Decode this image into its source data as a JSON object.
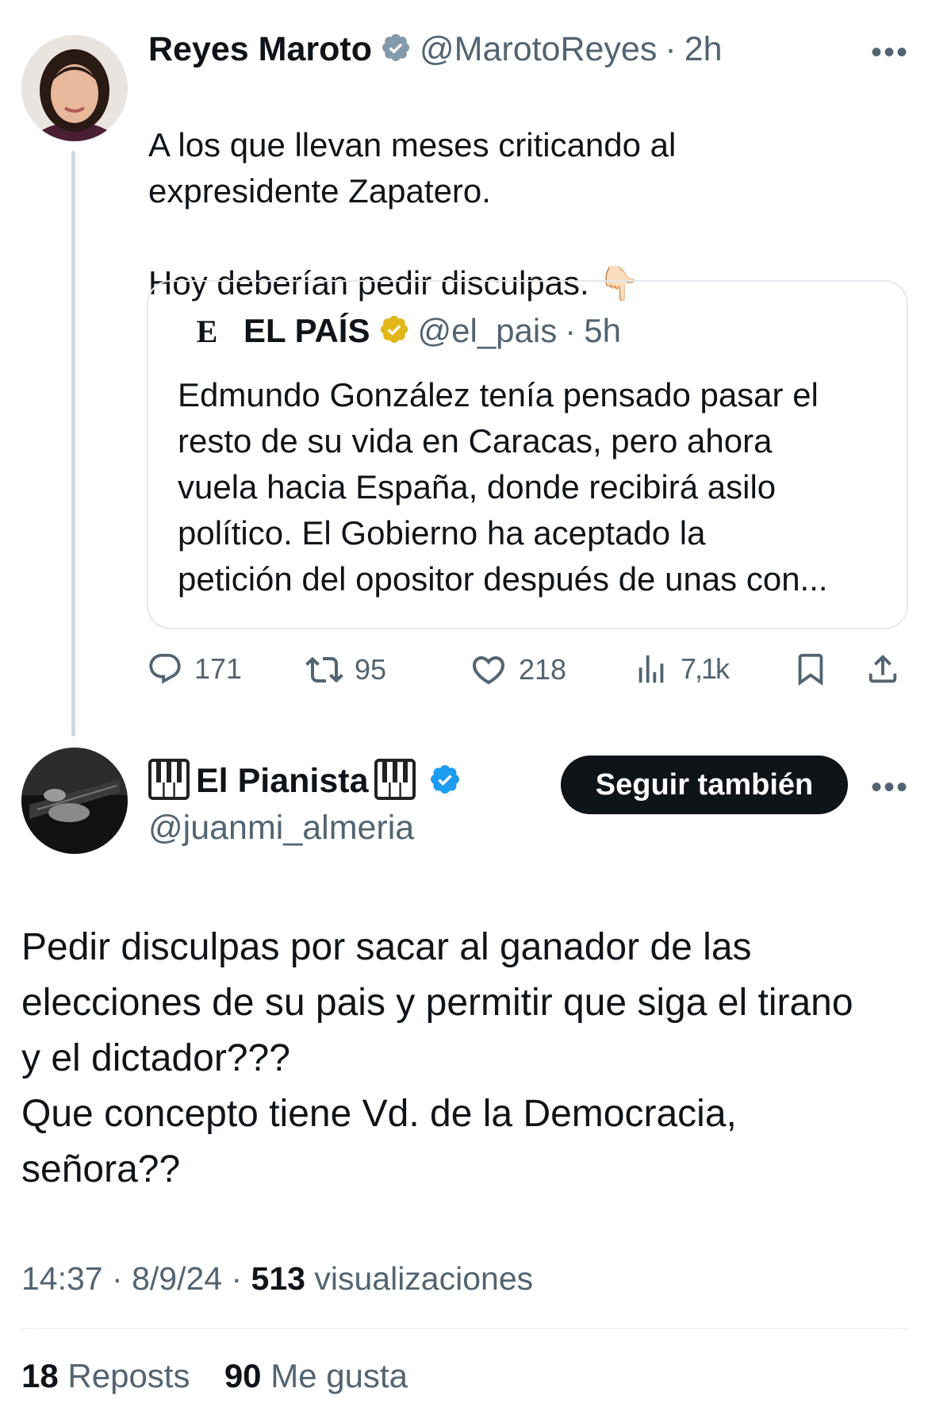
{
  "original_tweet": {
    "author_name": "Reyes Maroto",
    "handle": "@MarotoReyes",
    "time": "2h",
    "text": "A los que llevan meses criticando al\nexpresidente Zapatero.\n\nHoy deberían pedir disculpas.",
    "emoji": "👇🏻",
    "quote": {
      "logo": "E",
      "author_name": "EL PAÍS",
      "handle": "@el_pais",
      "time": "5h",
      "text": "Edmundo González tenía pensado pasar el\nresto de su vida en Caracas, pero ahora\nvuela hacia España, donde recibirá asilo\npolítico. El Gobierno ha aceptado la\npetición del opositor después de unas con..."
    },
    "actions": {
      "replies": "171",
      "reposts": "95",
      "likes": "218",
      "views": "7,1k"
    }
  },
  "reply_tweet": {
    "author_name": "El Pianista",
    "handle": "@juanmi_almeria",
    "follow_label": "Seguir también",
    "text": "Pedir disculpas por sacar al ganador de las\nelecciones de su pais y permitir que siga el tirano\ny el dictador???\nQue concepto tiene Vd. de la Democracia,\nseñora??",
    "time": "14:37",
    "date": "8/9/24",
    "views_count": "513",
    "views_label": "visualizaciones",
    "reposts_count": "18",
    "reposts_label": "Reposts",
    "likes_count": "90",
    "likes_label": "Me gusta"
  },
  "colors": {
    "text_primary": "#0f1419",
    "text_secondary": "#536471",
    "verified_blue": "#1d9bf0",
    "verified_gray": "#829aab",
    "verified_gold": "#e2b719",
    "thread_line": "#cfd9de"
  },
  "icons": [
    "verified-gray-icon",
    "verified-gold-icon",
    "verified-blue-icon",
    "reply-icon",
    "repost-icon",
    "like-icon",
    "views-icon",
    "bookmark-icon",
    "share-icon",
    "more-icon",
    "piano-icon"
  ]
}
